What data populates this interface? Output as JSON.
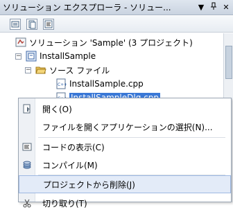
{
  "window": {
    "title": "ソリューション エクスプローラ - ソリュー...",
    "pin_glyph": "▼",
    "pin_alt_glyph": "ꟺ",
    "close_glyph": "✕"
  },
  "tree": {
    "solution_label": "ソリューション 'Sample' (3 プロジェクト)",
    "project_label": "InstallSample",
    "folder_label": "ソース ファイル",
    "file1_label": "InstallSample.cpp",
    "file2_label": "InstallSampleDlg.cpp",
    "expander_minus": "−",
    "file_icon_text": "C++"
  },
  "context_menu": {
    "items": [
      {
        "label": "開く(O)",
        "icon": "open-icon"
      },
      {
        "label": "ファイルを開くアプリケーションの選択(N)...",
        "icon": ""
      },
      {
        "label": "コードの表示(C)",
        "icon": "view-code-icon"
      },
      {
        "label": "コンパイル(M)",
        "icon": "compile-icon"
      },
      {
        "label": "プロジェクトから削除(J)",
        "icon": ""
      },
      {
        "label": "切り取り(T)",
        "icon": "cut-icon"
      }
    ],
    "highlight_color": "#e3ebf8"
  },
  "colors": {
    "selection": "#3a78d6",
    "titlebar": "#dfe6ef"
  }
}
